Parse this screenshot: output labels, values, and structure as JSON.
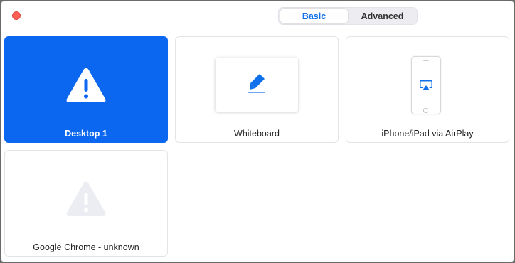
{
  "tabs": [
    {
      "label": "Basic",
      "active": true
    },
    {
      "label": "Advanced",
      "active": false
    }
  ],
  "tiles": [
    {
      "label": "Desktop 1",
      "icon": "warning-icon",
      "selected": true
    },
    {
      "label": "Whiteboard",
      "icon": "whiteboard-pen-icon",
      "selected": false
    },
    {
      "label": "iPhone/iPad via AirPlay",
      "icon": "airplay-icon",
      "selected": false
    },
    {
      "label": "Google Chrome - unknown",
      "icon": "warning-icon",
      "selected": false
    }
  ],
  "colors": {
    "accent": "#0b66f0",
    "close_button": "#fe5f57",
    "warning_light": "#ecedf3"
  }
}
